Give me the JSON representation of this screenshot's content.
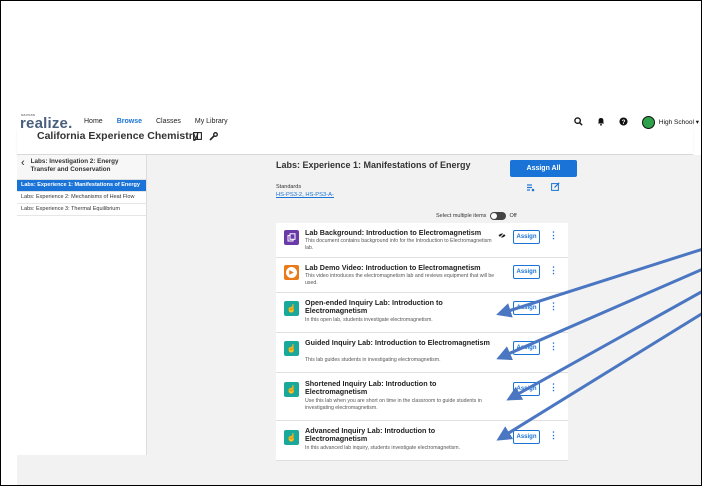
{
  "nav": {
    "logo_small": "savvas",
    "logo_main": "realize.",
    "links": [
      "Home",
      "Browse",
      "Classes",
      "My Library"
    ],
    "active_link": "Browse",
    "profile": "High School ▾"
  },
  "program": {
    "title": "California Experience Chemistry"
  },
  "sidebar": {
    "title": "Labs: Investigation 2: Energy Transfer and Conservation",
    "items": [
      "Labs: Experience 1: Manifestations of Energy",
      "Labs: Experience 2: Mechanisms of Heat Flow",
      "Labs: Experience 3: Thermal Equilibrium"
    ]
  },
  "main": {
    "title": "Labs: Experience 1: Manifestations of Energy",
    "assign_all": "Assign All",
    "standards_label": "Standards",
    "standards_links": "HS-PS3-2, HS-PS3-A-",
    "select_multiple": "Select multiple items",
    "toggle_state": "Off",
    "assign_label": "Assign",
    "items": [
      {
        "title": "Lab Background: Introduction to Electromagnetism",
        "desc": "This document contains background info for the Introduction to Electromagnetism lab.",
        "icon": "document-icon"
      },
      {
        "title": "Lab Demo Video: Introduction to Electromagnetism",
        "desc": "This video introduces the electromagnetism lab and reviews equipment that will be used.",
        "icon": "video-play-icon"
      },
      {
        "title": "Open-ended Inquiry Lab: Introduction to Electromagnetism",
        "desc": "In this open lab, students investigate electromagnetism.",
        "icon": "hand-pointer-icon"
      },
      {
        "title": "Guided Inquiry Lab: Introduction to Electromagnetism",
        "desc": "This lab guides students in investigating electromagnetism.",
        "icon": "hand-pointer-icon"
      },
      {
        "title": "Shortened Inquiry Lab: Introduction to Electromagnetism",
        "desc": "Use this lab when you are short on time in the classroom to guide students in investigating electromagnetism.",
        "icon": "hand-pointer-icon"
      },
      {
        "title": "Advanced Inquiry Lab: Introduction to Electromagnetism",
        "desc": "In this advanced lab inquiry, students investigate electromagnetism.",
        "icon": "hand-pointer-icon"
      }
    ]
  },
  "colors": {
    "brand_blue": "#1a73d6",
    "doc_tile": "#6a3aa8",
    "video_tile": "#ea7a18",
    "lab_tile": "#18a89c",
    "annotation_arrow": "#4a76c2"
  }
}
